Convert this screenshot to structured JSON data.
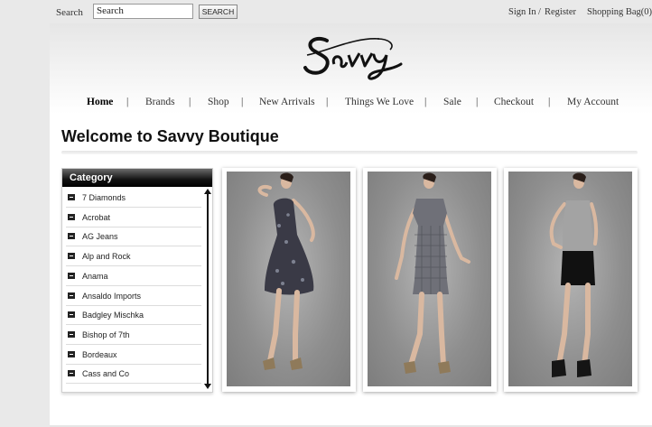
{
  "topbar": {
    "search_label": "Search",
    "search_value": "Search",
    "search_button": "SEARCH",
    "sign_in": "Sign In",
    "separator": "/",
    "register": "Register",
    "shopping_bag": "Shopping Bag(0)"
  },
  "brand": {
    "logo_text": "Savvy"
  },
  "nav": {
    "items": [
      "Home",
      "Brands",
      "Shop",
      "New Arrivals",
      "Things We Love",
      "Sale",
      "Checkout",
      "My Account"
    ],
    "separator": "|",
    "active": "Home"
  },
  "main": {
    "title": "Welcome to Savvy Boutique"
  },
  "category": {
    "title": "Category",
    "items": [
      "7 Diamonds",
      "Acrobat",
      "AG Jeans",
      "Alp and Rock",
      "Anama",
      "Ansaldo Imports",
      "Badgley Mischka",
      "Bishop of 7th",
      "Bordeaux",
      "Cass and Co"
    ]
  },
  "products": [
    {
      "image": "model-in-floral-halter-dress"
    },
    {
      "image": "model-in-gingham-cold-shoulder-dress"
    },
    {
      "image": "model-in-grey-tank-and-black-skirt"
    }
  ],
  "colors": {
    "page_bg": "#e9e9e9",
    "header_black": "#000000",
    "photo_bg": "#8e8e8e"
  }
}
